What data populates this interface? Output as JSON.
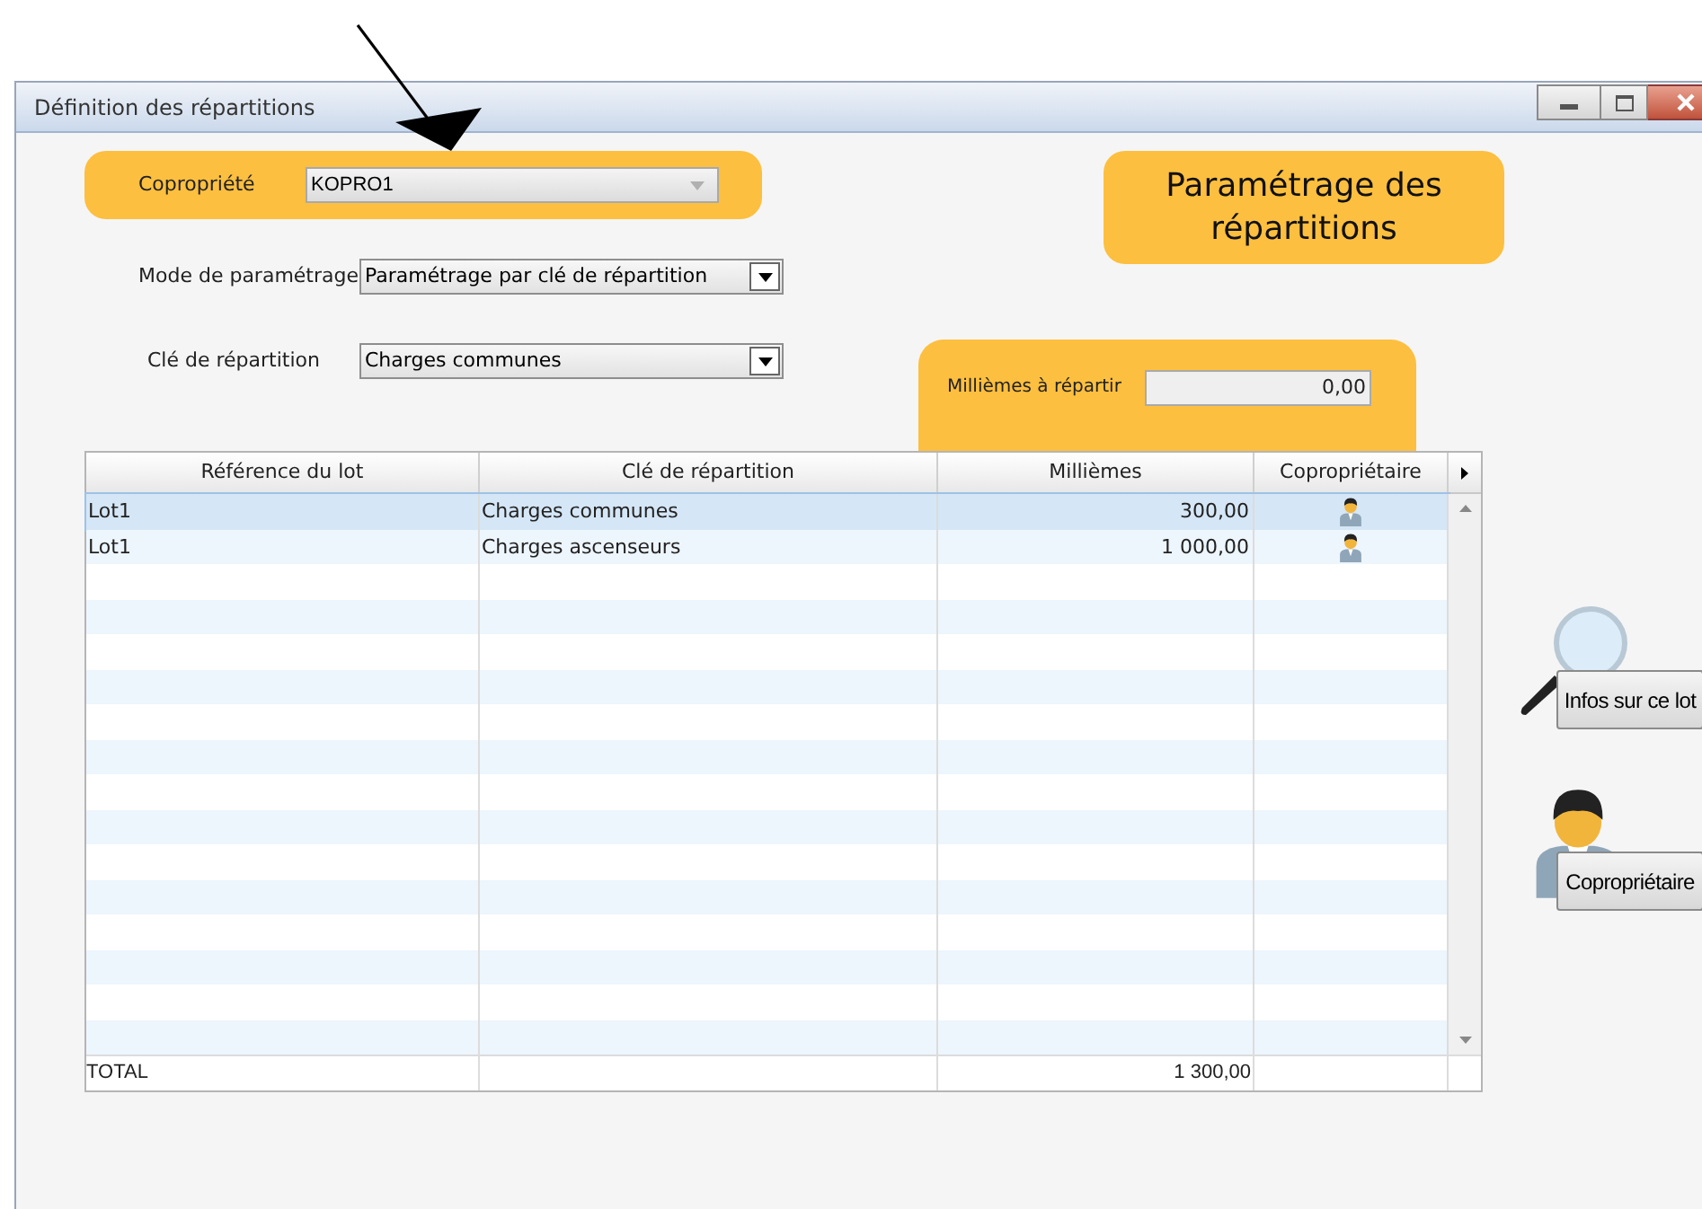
{
  "window": {
    "title": "Définition des répartitions"
  },
  "copropriete": {
    "label": "Copropriété",
    "value": "KOPRO1",
    "disabled": true
  },
  "panel_title": "Paramétrage des répartitions",
  "mode": {
    "label": "Mode de paramétrage",
    "value": "Paramétrage par clé de répartition",
    "disabled": false
  },
  "cle": {
    "label": "Clé de répartition",
    "value": "Charges communes",
    "disabled": false
  },
  "milliemes_a_repartir": {
    "label": "Millièmes à répartir",
    "value": "0,00"
  },
  "table": {
    "columns": [
      "Référence du lot",
      "Clé de répartition",
      "Millièmes",
      "Copropriétaire"
    ],
    "rows": [
      {
        "reference": "Lot1",
        "cle": "Charges communes",
        "milliemes": "300,00",
        "selected": true
      },
      {
        "reference": "Lot1",
        "cle": "Charges ascenseurs",
        "milliemes": "1 000,00",
        "selected": false
      }
    ],
    "total": {
      "label": "TOTAL",
      "milliemes": "1 300,00"
    }
  },
  "actions": [
    {
      "label": "Infos sur ce lot",
      "kind": "info"
    },
    {
      "label": "Copropriétaire",
      "kind": "owner"
    }
  ]
}
